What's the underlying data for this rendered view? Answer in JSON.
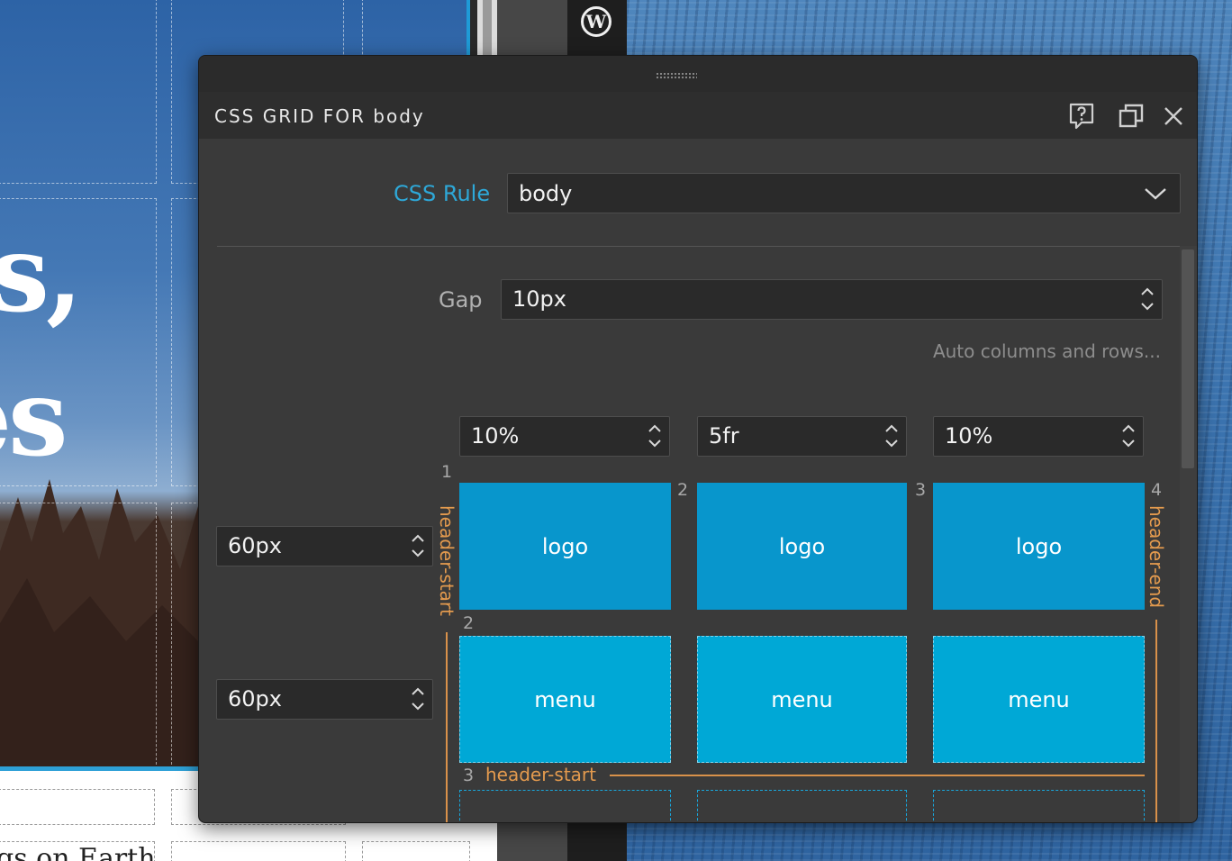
{
  "background": {
    "hero_words": [
      "ts,",
      "es"
    ],
    "footer_text": "gs on Earth"
  },
  "panel": {
    "title": "CSS GRID FOR body",
    "icons": {
      "help": "help-bubble-icon",
      "window": "detach-window-icon",
      "close": "close-icon"
    },
    "css_rule": {
      "label": "CSS Rule",
      "value": "body"
    },
    "gap": {
      "label": "Gap",
      "value": "10px"
    },
    "auto_link": "Auto columns and rows...",
    "columns": [
      "10%",
      "5fr",
      "10%"
    ],
    "rows": [
      "60px",
      "60px"
    ],
    "column_lines": [
      "1",
      "2",
      "3",
      "4"
    ],
    "row_lines": [
      "2",
      "3"
    ],
    "cells": {
      "row1": [
        "logo",
        "logo",
        "logo"
      ],
      "row2": [
        "menu",
        "menu",
        "menu"
      ]
    },
    "areas": {
      "left": "header-start",
      "right": "header-end",
      "bottom": "header-start"
    }
  },
  "colors": {
    "accent_blue": "#2ea8d8",
    "cell_logo": "#0896cc",
    "cell_menu": "#00a8d6",
    "area_orange": "#e39a4e"
  }
}
